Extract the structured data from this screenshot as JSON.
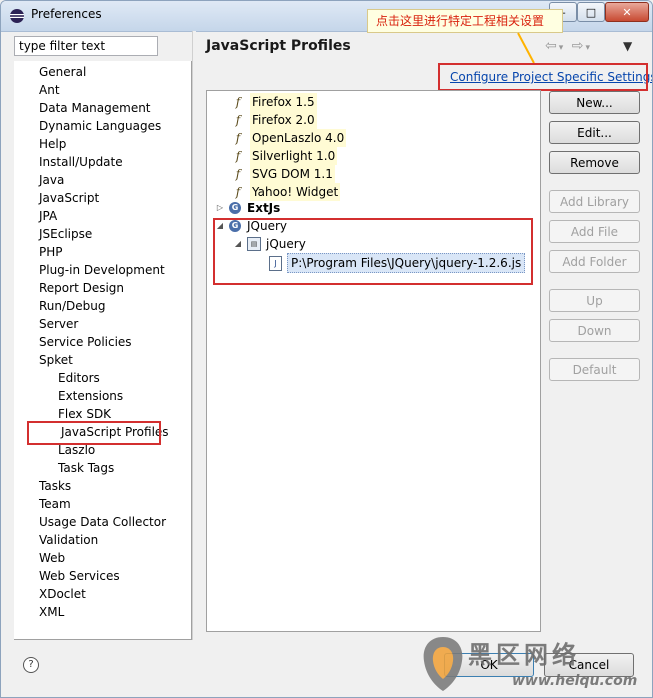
{
  "window": {
    "title": "Preferences",
    "controls": {
      "minimize": "–",
      "maximize": "□",
      "close": "✕"
    }
  },
  "filter": {
    "value": "type filter text"
  },
  "nav": {
    "items": [
      {
        "label": "General",
        "level": 1
      },
      {
        "label": "Ant",
        "level": 1
      },
      {
        "label": "Data Management",
        "level": 1
      },
      {
        "label": "Dynamic Languages",
        "level": 1
      },
      {
        "label": "Help",
        "level": 1
      },
      {
        "label": "Install/Update",
        "level": 1
      },
      {
        "label": "Java",
        "level": 1
      },
      {
        "label": "JavaScript",
        "level": 1
      },
      {
        "label": "JPA",
        "level": 1
      },
      {
        "label": "JSEclipse",
        "level": 1
      },
      {
        "label": "PHP",
        "level": 1
      },
      {
        "label": "Plug-in Development",
        "level": 1
      },
      {
        "label": "Report Design",
        "level": 1
      },
      {
        "label": "Run/Debug",
        "level": 1
      },
      {
        "label": "Server",
        "level": 1
      },
      {
        "label": "Service Policies",
        "level": 1
      },
      {
        "label": "Spket",
        "level": 1
      },
      {
        "label": "Editors",
        "level": 2
      },
      {
        "label": "Extensions",
        "level": 2
      },
      {
        "label": "Flex SDK",
        "level": 2
      },
      {
        "label": "JavaScript Profiles",
        "level": 2,
        "selected": true
      },
      {
        "label": "Laszlo",
        "level": 2
      },
      {
        "label": "Task Tags",
        "level": 2
      },
      {
        "label": "Tasks",
        "level": 1
      },
      {
        "label": "Team",
        "level": 1
      },
      {
        "label": "Usage Data Collector",
        "level": 1
      },
      {
        "label": "Validation",
        "level": 1
      },
      {
        "label": "Web",
        "level": 1
      },
      {
        "label": "Web Services",
        "level": 1
      },
      {
        "label": "XDoclet",
        "level": 1
      },
      {
        "label": "XML",
        "level": 1
      }
    ]
  },
  "page": {
    "title": "JavaScript Profiles",
    "back_icon": "⇦",
    "forward_icon": "⇨",
    "menu_icon": "▼",
    "config_link": "Configure Project Specific Settings...",
    "callout": "点击这里进行特定工程相关设置"
  },
  "libraries": {
    "profiles": [
      "Firefox 1.5",
      "Firefox 2.0",
      "OpenLaszlo 4.0",
      "Silverlight 1.0",
      "SVG DOM 1.1",
      "Yahoo! Widget"
    ],
    "groups": [
      {
        "label": "ExtJs",
        "expanded": false,
        "bold": true
      },
      {
        "label": "JQuery",
        "expanded": true,
        "bold": false
      }
    ],
    "jquery_child": "jQuery",
    "jquery_file": "P:\\Program Files\\JQuery\\jquery-1.2.6.js"
  },
  "buttons": {
    "new": "New...",
    "edit": "Edit...",
    "remove": "Remove",
    "add_library": "Add Library",
    "add_file": "Add File",
    "add_folder": "Add Folder",
    "up": "Up",
    "down": "Down",
    "default": "Default",
    "ok": "OK",
    "cancel": "Cancel",
    "help": "?"
  },
  "watermark": {
    "text": "黑区网络",
    "url": "www.heiqu.com"
  },
  "colors": {
    "annotation": "#d32f2f",
    "link": "#0645ad",
    "callout_text": "#d9230f"
  }
}
